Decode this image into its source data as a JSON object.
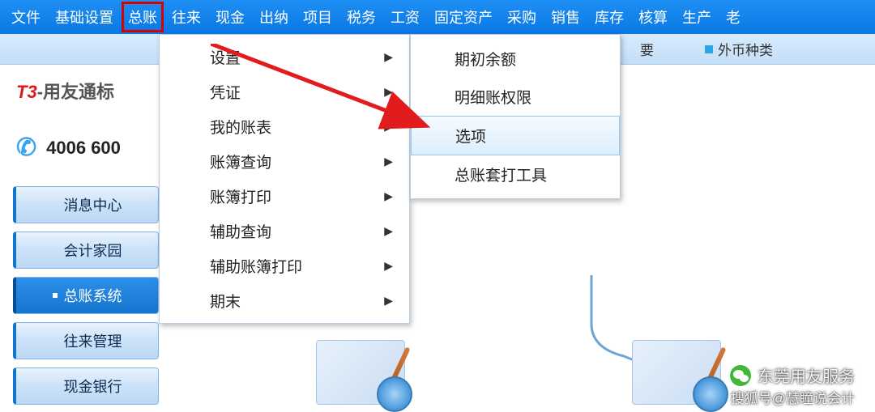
{
  "menubar": {
    "items": [
      "文件",
      "基础设置",
      "总账",
      "往来",
      "现金",
      "出纳",
      "项目",
      "税务",
      "工资",
      "固定资产",
      "采购",
      "销售",
      "库存",
      "核算",
      "生产",
      "老"
    ]
  },
  "logo": {
    "prefix": "T3",
    "suffix": "-用友通标"
  },
  "phone": "4006 600",
  "sidebar": {
    "items": [
      {
        "label": "消息中心",
        "active": false
      },
      {
        "label": "会计家园",
        "active": false
      },
      {
        "label": "总账系统",
        "active": true
      },
      {
        "label": "往来管理",
        "active": false
      },
      {
        "label": "现金银行",
        "active": false
      }
    ]
  },
  "dropdown1": {
    "items": [
      {
        "label": "设置",
        "arrow": true
      },
      {
        "label": "凭证",
        "arrow": true
      },
      {
        "label": "我的账表",
        "arrow": true
      },
      {
        "label": "账簿查询",
        "arrow": true
      },
      {
        "label": "账簿打印",
        "arrow": true
      },
      {
        "label": "辅助查询",
        "arrow": true
      },
      {
        "label": "辅助账簿打印",
        "arrow": true
      },
      {
        "label": "期末",
        "arrow": true
      }
    ]
  },
  "dropdown2": {
    "items": [
      {
        "label": "期初余额",
        "hover": false
      },
      {
        "label": "明细账权限",
        "hover": false
      },
      {
        "label": "选项",
        "hover": true
      },
      {
        "label": "总账套打工具",
        "hover": false
      }
    ]
  },
  "toolbar": {
    "link1": "要",
    "link2": "外币种类"
  },
  "watermark": {
    "brand": "东莞用友服务",
    "credit": "搜狐号@慧瞳说会计"
  }
}
